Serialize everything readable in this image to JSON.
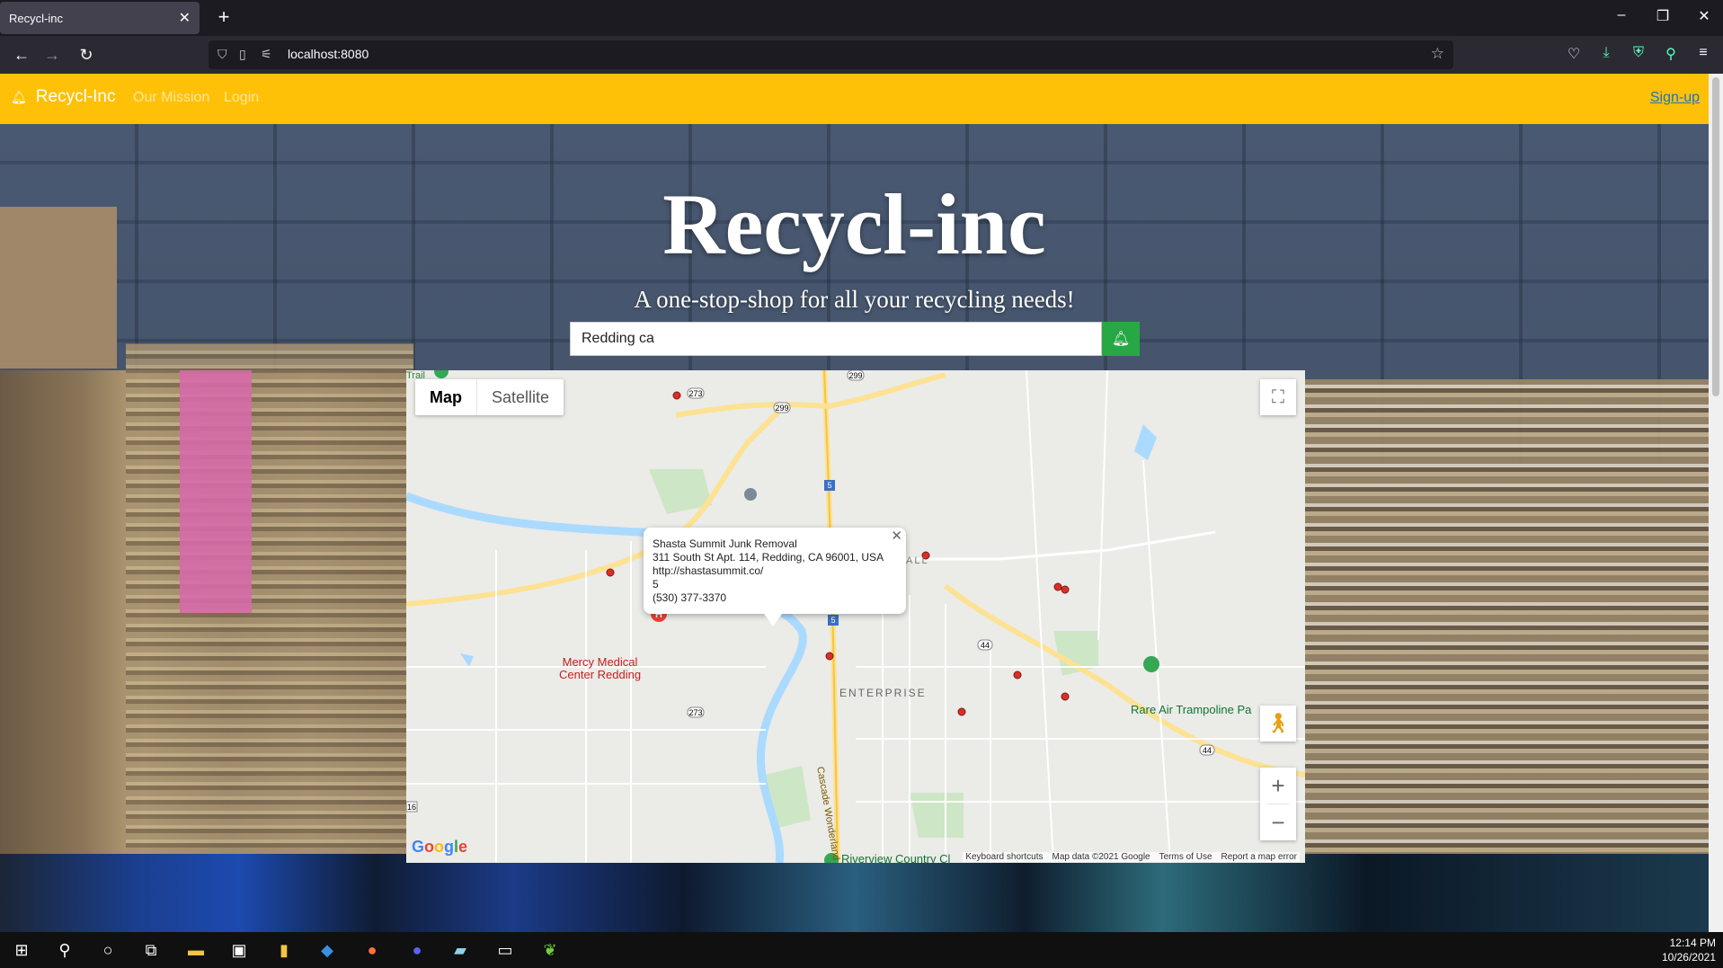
{
  "browser": {
    "tab_title": "Recycl-inc",
    "url": "localhost:8080"
  },
  "app": {
    "brand": "Recycl-Inc",
    "nav_links": [
      "Our Mission",
      "Login"
    ],
    "signup": "Sign-up",
    "accent_color": "#ffc107",
    "button_color": "#28a745"
  },
  "hero": {
    "title": "Recycl-inc",
    "subtitle": "A one-stop-shop for all your recycling needs!",
    "search_value": "Redding ca"
  },
  "map": {
    "type_buttons": [
      "Map",
      "Satellite"
    ],
    "active_type": "Map",
    "info_window": {
      "name": "Shasta Summit Junk Removal",
      "address": "311 South St Apt. 114, Redding, CA 96001, USA",
      "website": "http://shastasummit.co/",
      "rating": "5",
      "phone": "(530) 377-3370"
    },
    "labels": {
      "hospital": "Mercy Medical Center Redding",
      "hospital_line1": "Mercy Medical",
      "hospital_line2": "Center Redding",
      "enterprise": "ENTERPRISE",
      "trampoline": "Rare Air Trampoline Pa",
      "riverview": "Riverview Country Cl",
      "trail": "Trail",
      "all": "ALL",
      "cascade": "Cascade Wonderland Hwy"
    },
    "road_labels": [
      "273",
      "299",
      "299",
      "5",
      "5",
      "44",
      "44",
      "273",
      "16"
    ],
    "attribution": [
      "Keyboard shortcuts",
      "Map data ©2021 Google",
      "Terms of Use",
      "Report a map error"
    ],
    "google_logo": "Google"
  },
  "taskbar": {
    "time": "12:14 PM",
    "date": "10/26/2021"
  }
}
